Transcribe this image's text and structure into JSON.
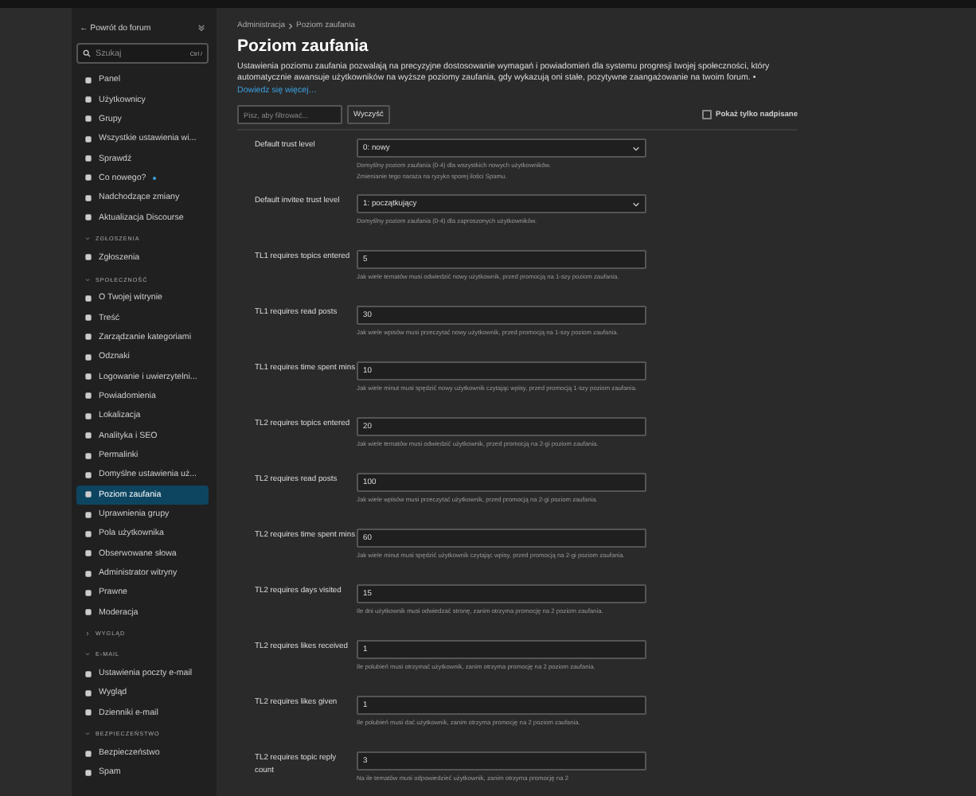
{
  "sidebar": {
    "back_link": "← Powrót do forum",
    "search": {
      "placeholder": "Szukaj",
      "shortcut": "Ctrl /"
    },
    "groups": [
      {
        "items": [
          {
            "label": "Panel",
            "selected": false
          },
          {
            "label": "Użytkownicy",
            "selected": false
          },
          {
            "label": "Grupy",
            "selected": false
          },
          {
            "label": "Wszystkie ustawienia wi...",
            "selected": false
          },
          {
            "label": "Sprawdź",
            "selected": false
          },
          {
            "label": "Co nowego?",
            "selected": false,
            "unread": true
          },
          {
            "label": "Nadchodzące zmiany",
            "selected": false
          },
          {
            "label": "Aktualizacja Discourse",
            "selected": false
          }
        ]
      },
      {
        "title": "ZGŁOSZENIA",
        "expanded": true,
        "items": [
          {
            "label": "Zgłoszenia",
            "selected": false
          }
        ]
      },
      {
        "title": "SPOŁECZNOŚĆ",
        "expanded": true,
        "items": [
          {
            "label": "O Twojej witrynie",
            "selected": false
          },
          {
            "label": "Treść",
            "selected": false
          },
          {
            "label": "Zarządzanie kategoriami",
            "selected": false
          },
          {
            "label": "Odznaki",
            "selected": false
          },
          {
            "label": "Logowanie i uwierzytelni...",
            "selected": false
          },
          {
            "label": "Powiadomienia",
            "selected": false
          },
          {
            "label": "Lokalizacja",
            "selected": false
          },
          {
            "label": "Analityka i SEO",
            "selected": false
          },
          {
            "label": "Permalinki",
            "selected": false
          },
          {
            "label": "Domyślne ustawienia uż...",
            "selected": false
          },
          {
            "label": "Poziom zaufania",
            "selected": true
          },
          {
            "label": "Uprawnienia grupy",
            "selected": false
          },
          {
            "label": "Pola użytkownika",
            "selected": false
          },
          {
            "label": "Obserwowane słowa",
            "selected": false
          },
          {
            "label": "Administrator witryny",
            "selected": false
          },
          {
            "label": "Prawne",
            "selected": false
          },
          {
            "label": "Moderacja",
            "selected": false
          }
        ]
      },
      {
        "title": "WYGLĄD",
        "expanded": false
      },
      {
        "title": "E-MAIL",
        "expanded": true,
        "items": [
          {
            "label": "Ustawienia poczty e-mail",
            "selected": false
          },
          {
            "label": "Wygląd",
            "selected": false
          },
          {
            "label": "Dzienniki e-mail",
            "selected": false
          }
        ]
      },
      {
        "title": "BEZPIECZEŃSTWO",
        "expanded": true,
        "items": [
          {
            "label": "Bezpieczeństwo",
            "selected": false
          },
          {
            "label": "Spam",
            "selected": false
          }
        ]
      }
    ]
  },
  "breadcrumb": [
    "Administracja",
    "Poziom zaufania"
  ],
  "title": "Poziom zaufania",
  "description": "Ustawienia poziomu zaufania pozwalają na precyzyjne dostosowanie wymagań i powiadomień dla systemu progresji twojej społeczności, który automatycznie awansuje użytkowników na wyższe poziomy zaufania, gdy wykazują oni stałe, pozytywne zaangażowanie na twoim forum. •",
  "learn_more": "Dowiedz się więcej…",
  "filter": {
    "placeholder": "Pisz, aby filtrować...",
    "clear_button": "Wyczyść",
    "only_overridden": {
      "label": "Pokaż tylko nadpisane",
      "checked": false
    }
  },
  "settings": [
    {
      "kind": "select",
      "label": "Default trust level",
      "value": "0: nowy",
      "hint": [
        "Domyślny poziom zaufania (0-4) dla wszystkich nowych użytkowników.",
        "Zmienianie tego naraża na ryzyko sporej ilości Spamu."
      ]
    },
    {
      "kind": "select",
      "label": "Default invitee trust level",
      "value": "1: początkujący",
      "hint": [
        "Domyślny poziom zaufania (0-4) dla zaproszonych użytkowników."
      ]
    },
    {
      "kind": "number",
      "label": "TL1 requires topics entered",
      "value": "5",
      "hint": [
        "Jak wiele tematów musi odwiedzić nowy użytkownik, przed promocją na 1-szy poziom zaufania."
      ]
    },
    {
      "kind": "number",
      "label": "TL1 requires read posts",
      "value": "30",
      "hint": [
        "Jak wiele wpisów musi przeczytać nowy użytkownik, przed promocją na 1-szy poziom zaufania."
      ]
    },
    {
      "kind": "number",
      "label": "TL1 requires time spent mins",
      "value": "10",
      "hint": [
        "Jak wiele minut musi spędzić nowy użytkownik czytając wpisy, przed promocją 1-szy poziom zaufania."
      ]
    },
    {
      "kind": "number",
      "label": "TL2 requires topics entered",
      "value": "20",
      "hint": [
        "Jak wiele tematów musi odwiedzić użytkownik, przed promocją na 2-gi poziom zaufania."
      ]
    },
    {
      "kind": "number",
      "label": "TL2 requires read posts",
      "value": "100",
      "hint": [
        "Jak wiele wpisów musi przeczytać użytkownik, przed promocją na 2-gi poziom zaufania."
      ]
    },
    {
      "kind": "number",
      "label": "TL2 requires time spent mins",
      "value": "60",
      "hint": [
        "Jak wiele minut musi spędzić użytkownik czytając wpisy, przed promocją na 2-gi poziom zaufania."
      ]
    },
    {
      "kind": "number",
      "label": "TL2 requires days visited",
      "value": "15",
      "hint": [
        "Ile dni użytkownik musi odwiedzać stronę, zanim otrzyma promocję na 2 poziom zaufania."
      ]
    },
    {
      "kind": "number",
      "label": "TL2 requires likes received",
      "value": "1",
      "hint": [
        "Ile polubień musi otrzymać użytkownik, zanim otrzyma promocję na 2 poziom zaufania."
      ]
    },
    {
      "kind": "number",
      "label": "TL2 requires likes given",
      "value": "1",
      "hint": [
        "Ile polubień musi dać użytkownik, zanim otrzyma promocję na 2 poziom zaufania."
      ]
    },
    {
      "kind": "number",
      "label": "TL2 requires topic reply count",
      "value": "3",
      "hint": [
        "Na ile tematów musi odpowiedzieć użytkownik, zanim otrzyma promocję na 2"
      ]
    }
  ]
}
